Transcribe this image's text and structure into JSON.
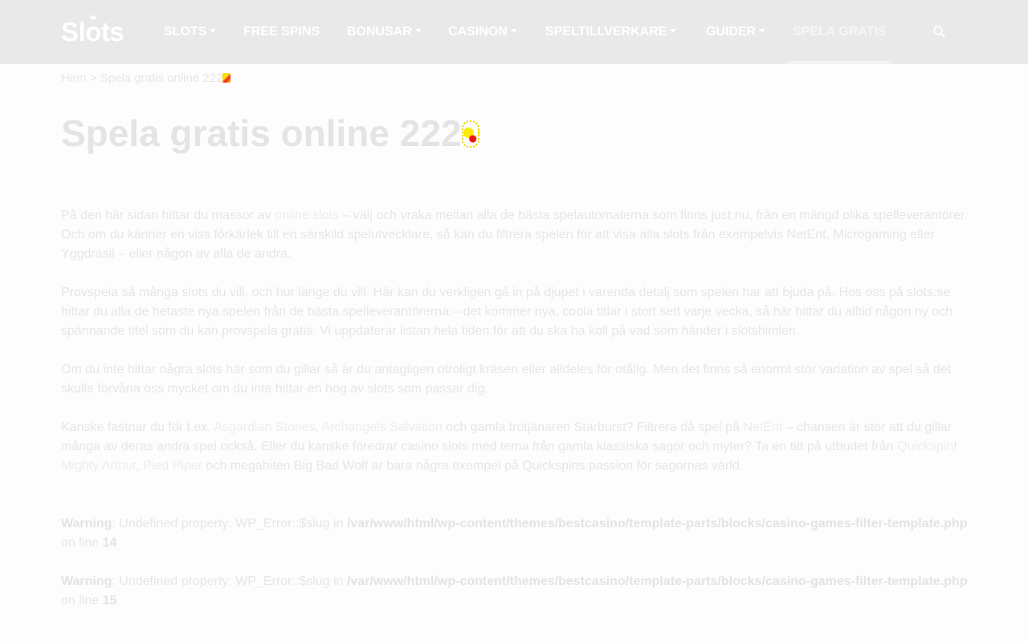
{
  "header": {
    "logo_text_a": "Sl",
    "logo_text_b": "ts",
    "nav": [
      {
        "label": "SLOTS",
        "dropdown": true
      },
      {
        "label": "FREE SPINS",
        "dropdown": false
      },
      {
        "label": "BONUSAR",
        "dropdown": true
      },
      {
        "label": "CASINON",
        "dropdown": true
      },
      {
        "label": "SPELTILLVERKARE",
        "dropdown": true
      },
      {
        "label": "GUIDER",
        "dropdown": true
      },
      {
        "label": "SPELA GRATIS",
        "dropdown": false,
        "active": true
      }
    ],
    "search_icon": "search-icon"
  },
  "breadcrumb": {
    "home": "Hem",
    "separator": ">",
    "current": "Spela gratis online 222"
  },
  "page_title": "Spela gratis online 222",
  "content": {
    "p1": {
      "a": "På den här sidan hittar du massor av ",
      "link": "online slots",
      "b": " – välj och vraka mellan alla de bästa spelautomaterna som finns just nu, från en mängd olika spelleverantörer. Och om du känner en viss förkärlek till en särskild spelutvecklare, så kan du filtrera spelen för att visa alla slots från exempelvis NetEnt, Microgaming eller Yggdrasil – eller någon av alla de andra."
    },
    "p2": "Provspela så många slots du vill, och hur länge du vill. Här kan du verkligen gå in på djupet i varenda detalj som spelen har att bjuda på. Hos oss på slots.se hittar du alla de hetaste nya spelen från de bästa spelleverantörerna – det kommer nya, coola titlar i stort sett varje vecka, så här hittar du alltid någon ny och spännande titel som du kan provspela gratis. Vi uppdaterar listan hela tiden för att du ska ha koll på vad som händer i slotshimlen.",
    "p3": "Om du inte hittar några slots här som du gillar så är du antagligen otroligt kräsen eller alldeles för otålig. Men det finns så enormt stor variation av spel så det skulle förvåna oss mycket om du inte hittar en hög av slots som passar dig.",
    "p4": {
      "a": "Kanske fastnar du för t.ex. ",
      "link1": "Asgardian Stones",
      "sep1": ", ",
      "link2": "Archangels Salvation",
      "b": " och gamla trotjänaren Starburst? Filtrera då spel på ",
      "link3": "NetEnt",
      "c": " – chansen är stor att du gillar många av deras andra spel också. Eller du kanske föredrar casino slots med tema från gamla klassiska sagor och myter? Ta en titt på utbudet från ",
      "link4": "Quickspin",
      "d": "! ",
      "link5": "Mighty Arthur",
      "sep2": ", ",
      "link6": "Pied Piper",
      "e": " och megahiten Big Bad Wolf är bara några exempel på Quickspins passion för sagornas värld."
    }
  },
  "warnings": [
    {
      "label": "Warning",
      "message": ": Undefined property: WP_Error::$slug in ",
      "path": "/var/www/html/wp-content/themes/bestcasino/template-parts/blocks/casino-games-filter-template.php",
      "online": " on line ",
      "line": "14"
    },
    {
      "label": "Warning",
      "message": ": Undefined property: WP_Error::$slug in ",
      "path": "/var/www/html/wp-content/themes/bestcasino/template-parts/blocks/casino-games-filter-template.php",
      "online": " on line ",
      "line": "15"
    }
  ]
}
